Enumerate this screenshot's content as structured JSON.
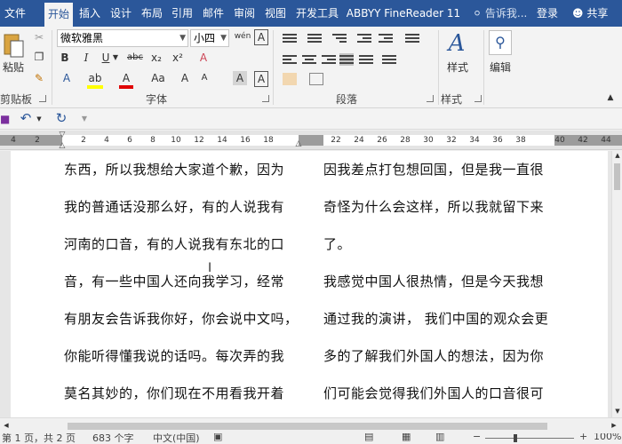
{
  "tabs": [
    "文件",
    "开始",
    "插入",
    "设计",
    "布局",
    "引用",
    "邮件",
    "审阅",
    "视图",
    "开发工具",
    "ABBYY FineReader 11"
  ],
  "active_tab": "开始",
  "tell_me": "告诉我...",
  "login": "登录",
  "share": "共享",
  "clipboard": {
    "paste_label": "粘贴",
    "group_label": "剪贴板"
  },
  "font": {
    "name": "微软雅黑",
    "size": "小四",
    "wen_icon": "wén",
    "bold": "B",
    "italic": "I",
    "underline": "U",
    "strike": "abc",
    "sub": "x₂",
    "sup": "x²",
    "clear_format": "A",
    "aa": "Aa",
    "grow": "A",
    "shrink": "A",
    "highlight": "ab",
    "font_color": "A",
    "char_shade": "A",
    "char_border": "A",
    "group_label": "字体"
  },
  "paragraph": {
    "group_label": "段落"
  },
  "styles": {
    "styles_label": "样式",
    "group_label": "样式"
  },
  "editing": {
    "editing_label": "编辑"
  },
  "colors": {
    "tabbar": "#2b579a",
    "highlight": "#ffff00",
    "font_color": "#e00000"
  },
  "ruler": {
    "left_nums": [
      "4",
      "2",
      "",
      "2",
      "4",
      "6",
      "8",
      "10",
      "12",
      "14",
      "16",
      "18"
    ],
    "right_nums": [
      "22",
      "24",
      "26",
      "28",
      "30",
      "32",
      "34",
      "36",
      "38",
      "40",
      "42"
    ],
    "extra": "44"
  },
  "document": {
    "left_column": [
      "东西，所以我想给大家道个歉，因为",
      "我的普通话没那么好，有的人说我有",
      "河南的口音，有的人说我有东北的口",
      "音，有一些中国人还向我学习，经常",
      "有朋友会告诉我你好，你会说中文吗，",
      "你能听得懂我说的话吗。每次弄的我",
      "莫名其妙的，你们现在不用看我开着"
    ],
    "right_column": [
      "因我差点打包想回国，但是我一直很",
      "奇怪为什么会这样，所以我就留下来",
      "了。",
      "我感觉中国人很热情，但是今天我想",
      "通过我的演讲， 我们中国的观众会更",
      "多的了解我们外国人的想法，因为你",
      "们可能会觉得我们外国人的口音很可"
    ]
  },
  "status": {
    "page": "第 1 页，共 2 页",
    "words": "683 个字",
    "lang": "中文(中国)",
    "zoom": "100%"
  }
}
